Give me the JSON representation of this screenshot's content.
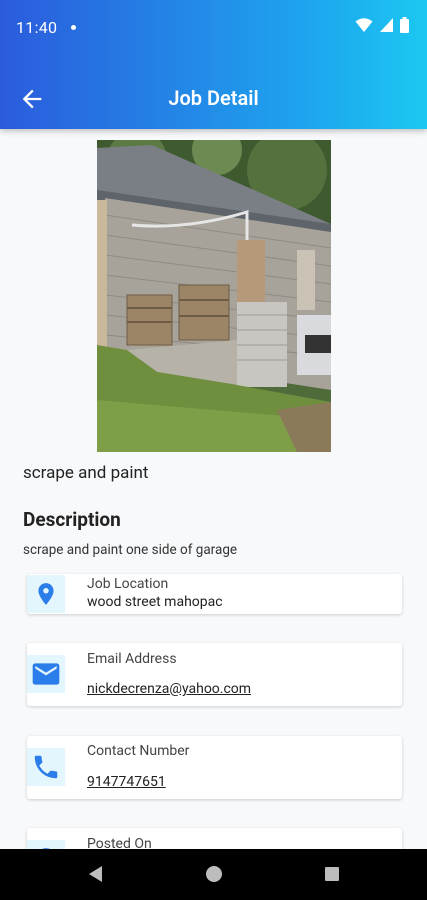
{
  "status": {
    "time": "11:40"
  },
  "header": {
    "title": "Job Detail"
  },
  "job": {
    "title": "scrape and paint",
    "description_heading": "Description",
    "description": "scrape and paint one side of garage"
  },
  "cards": {
    "location": {
      "label": "Job Location",
      "value": "wood street mahopac"
    },
    "email": {
      "label": "Email Address",
      "value": "nickdecrenza@yahoo.com"
    },
    "phone": {
      "label": "Contact Number",
      "value": "9147747651"
    },
    "posted": {
      "label": "Posted On"
    }
  },
  "colors": {
    "accent": "#2b7de9",
    "header_start": "#2b5bdc",
    "header_end": "#1bc8f0",
    "icon_bg": "#e3f6fd"
  },
  "icons": {
    "back": "arrow-left-icon",
    "location": "location-pin-icon",
    "email": "envelope-icon",
    "phone": "phone-icon",
    "posted": "calendar-icon"
  }
}
